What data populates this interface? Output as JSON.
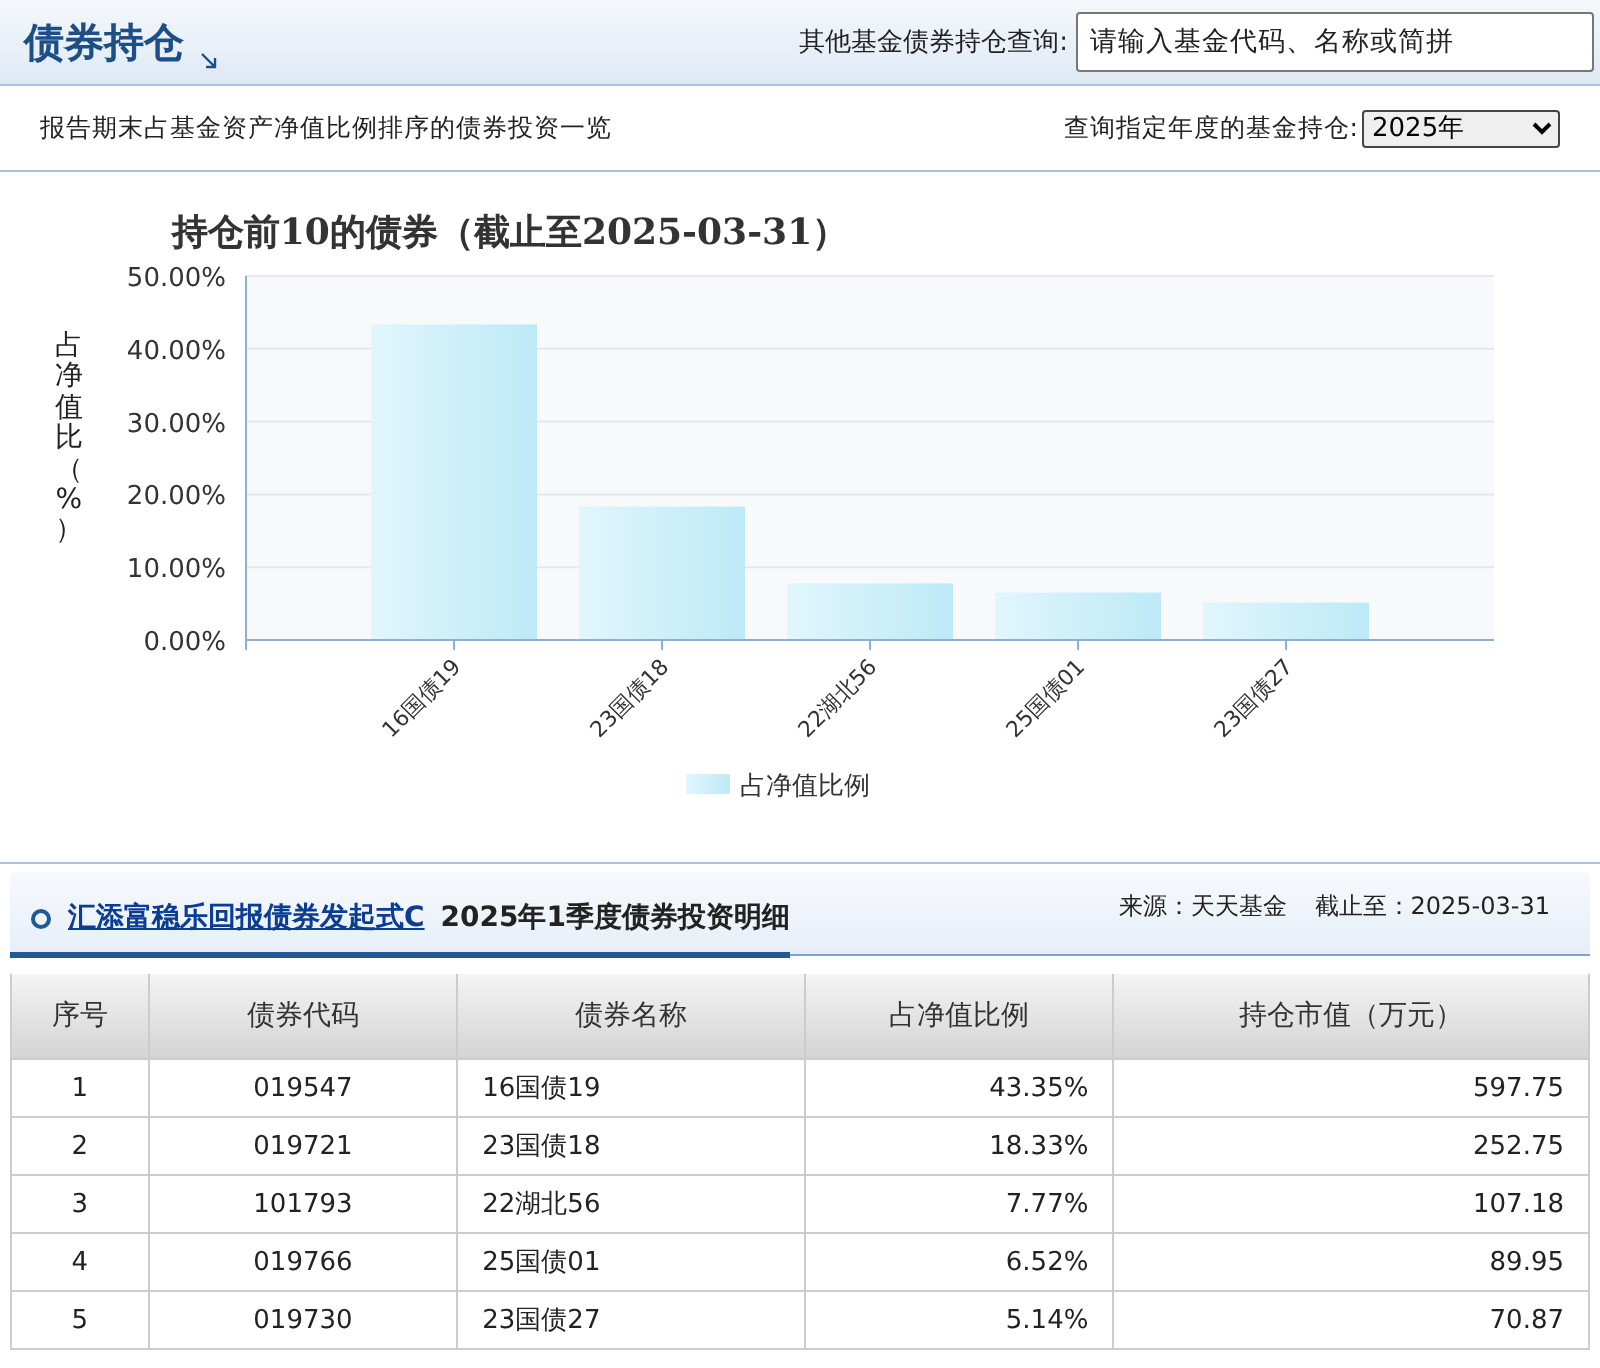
{
  "header": {
    "title": "债券持仓",
    "search_label": "其他基金债券持仓查询:",
    "search_placeholder": "请输入基金代码、名称或简拼"
  },
  "subheader": {
    "description": "报告期末占基金资产净值比例排序的债券投资一览",
    "year_label": "查询指定年度的基金持仓:",
    "year_value": "2025年"
  },
  "chart": {
    "chart_data": {
      "type": "bar",
      "title": "持仓前10的债券（截止至2025-03-31）",
      "ylabel": "占净值比（%）",
      "categories": [
        "16国债19",
        "23国债18",
        "22湖北56",
        "25国债01",
        "23国债27"
      ],
      "series": [
        {
          "name": "占净值比例",
          "color": "#bde9f7",
          "values": [
            43.35,
            18.33,
            7.77,
            6.52,
            5.14
          ]
        }
      ],
      "ylim": [
        0,
        50
      ],
      "grid": true,
      "yticks": [
        {
          "value": 0,
          "label": "0.00%"
        },
        {
          "value": 10,
          "label": "10.00%"
        },
        {
          "value": 20,
          "label": "20.00%"
        },
        {
          "value": 30,
          "label": "30.00%"
        },
        {
          "value": 40,
          "label": "40.00%"
        },
        {
          "value": 50,
          "label": "50.00%"
        }
      ]
    }
  },
  "section": {
    "fund_link": "汇添富稳乐回报债券发起式C",
    "title": "2025年1季度债券投资明细",
    "source": "来源：天天基金",
    "as_of": "截止至：2025-03-31"
  },
  "table": {
    "columns": [
      "序号",
      "债券代码",
      "债券名称",
      "占净值比例",
      "持仓市值（万元）"
    ],
    "rows": [
      [
        "1",
        "019547",
        "16国债19",
        "43.35%",
        "597.75"
      ],
      [
        "2",
        "019721",
        "23国债18",
        "18.33%",
        "252.75"
      ],
      [
        "3",
        "101793",
        "22湖北56",
        "7.77%",
        "107.18"
      ],
      [
        "4",
        "019766",
        "25国债01",
        "6.52%",
        "89.95"
      ],
      [
        "5",
        "019730",
        "23国债27",
        "5.14%",
        "70.87"
      ]
    ]
  }
}
